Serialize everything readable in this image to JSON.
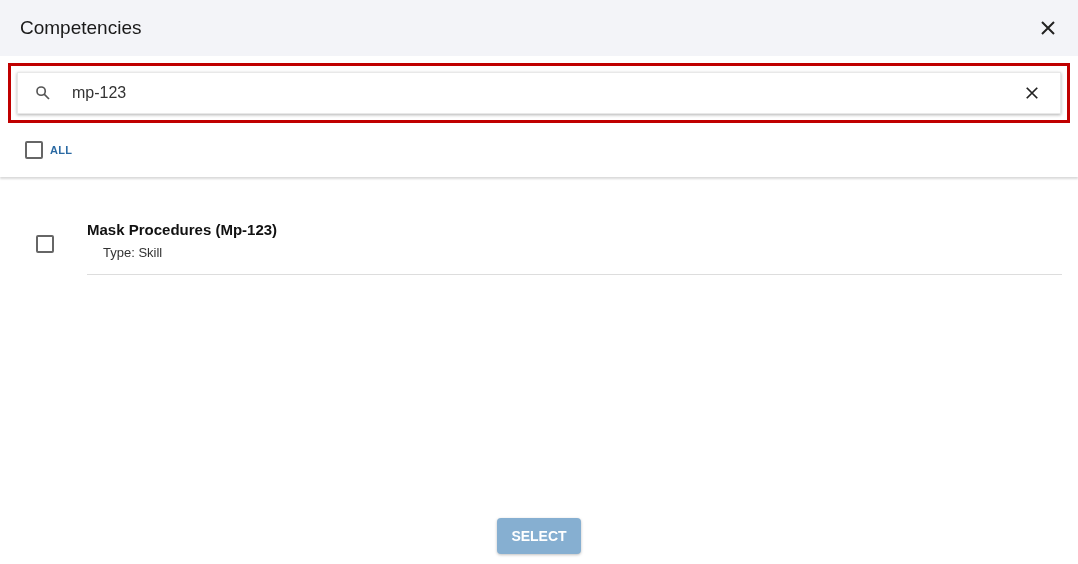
{
  "dialog": {
    "title": "Competencies"
  },
  "search": {
    "value": "mp-123",
    "highlighted": true
  },
  "select_all": {
    "label": "ALL",
    "checked": false
  },
  "items": [
    {
      "title": "Mask Procedures (Mp-123)",
      "subtitle": "Type: Skill",
      "checked": false
    }
  ],
  "select_button": {
    "label": "SELECT",
    "disabled": true
  }
}
